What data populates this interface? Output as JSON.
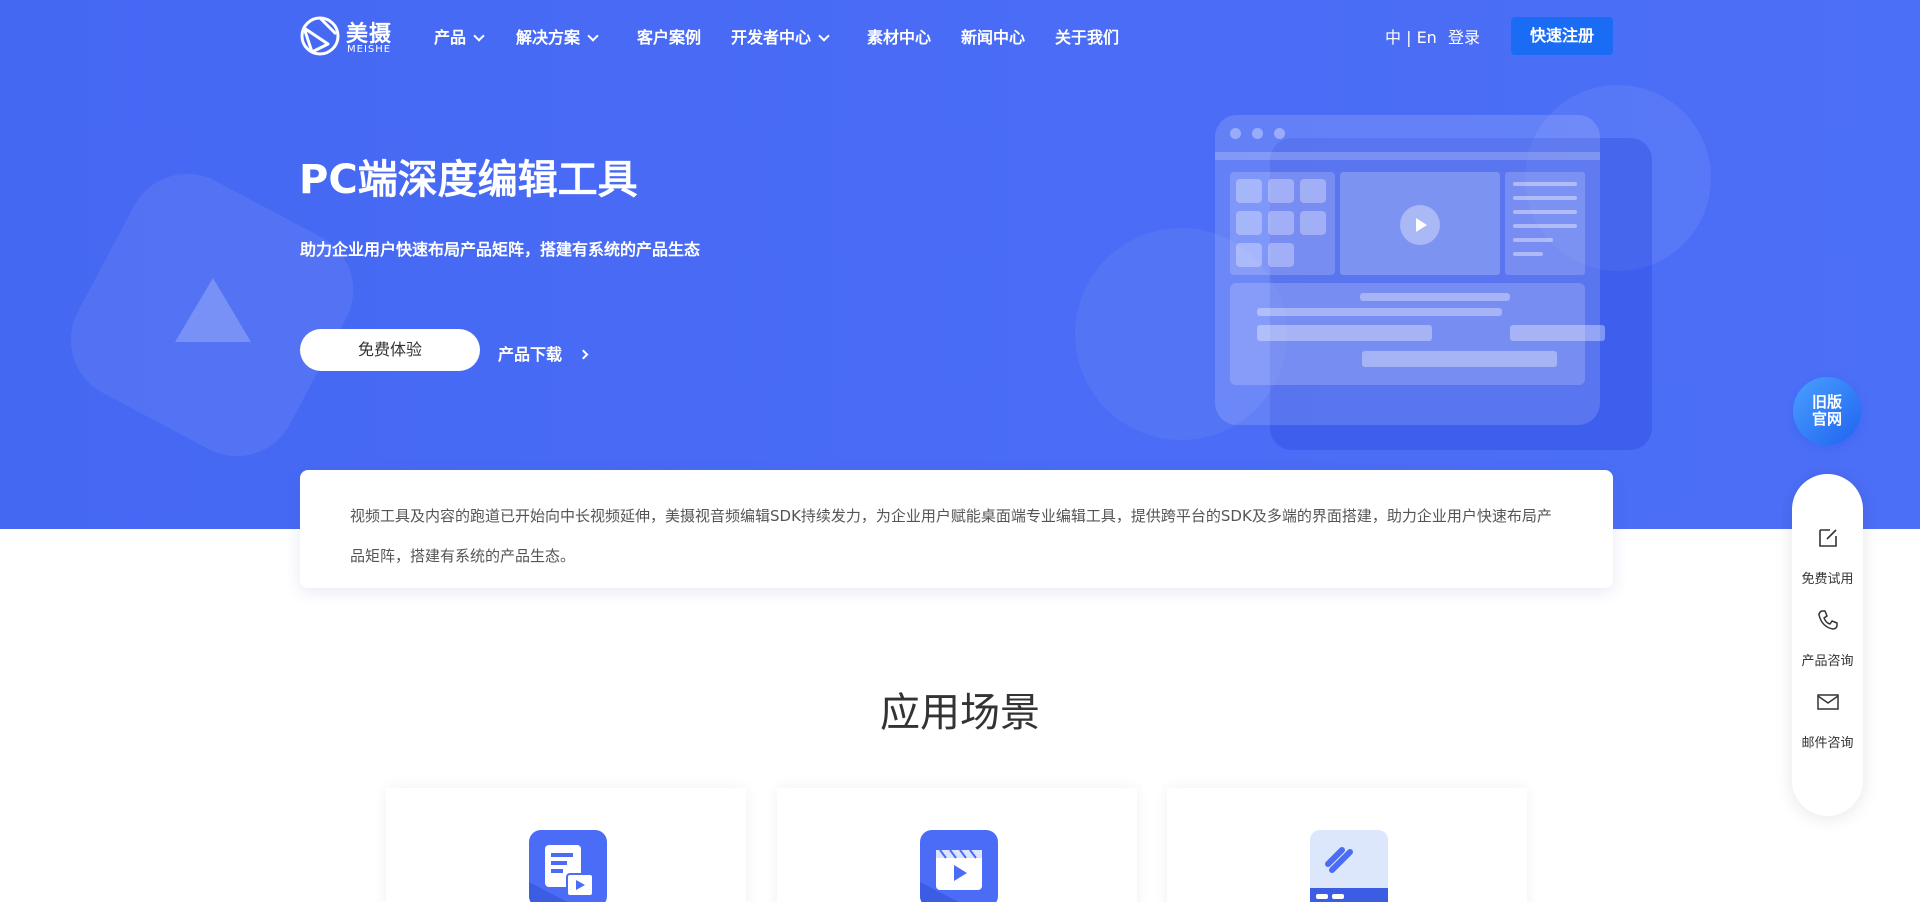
{
  "brand": {
    "name_cn": "美摄",
    "name_en": "MEISHE"
  },
  "nav": {
    "items": [
      {
        "label": "产品",
        "dropdown": true
      },
      {
        "label": "解决方案",
        "dropdown": true
      },
      {
        "label": "客户案例",
        "dropdown": false
      },
      {
        "label": "开发者中心",
        "dropdown": true
      },
      {
        "label": "素材中心",
        "dropdown": false
      },
      {
        "label": "新闻中心",
        "dropdown": false
      },
      {
        "label": "关于我们",
        "dropdown": false
      }
    ],
    "lang": "中 | En",
    "login": "登录",
    "register": "快速注册"
  },
  "hero": {
    "title": "PC端深度编辑工具",
    "subtitle": "助力企业用户快速布局产品矩阵，搭建有系统的产品生态",
    "trial_button": "免费体验",
    "download_link": "产品下载"
  },
  "intro": {
    "text": "视频工具及内容的跑道已开始向中长视频延伸，美摄视音频编辑SDK持续发力，为企业用户赋能桌面端专业编辑工具，提供跨平台的SDK及多端的界面搭建，助力企业用户快速布局产品矩阵，搭建有系统的产品生态。"
  },
  "section": {
    "title": "应用场景"
  },
  "scenes": [
    {
      "icon": "document-video-icon"
    },
    {
      "icon": "video-clapper-icon"
    },
    {
      "icon": "editor-window-icon"
    }
  ],
  "floating": {
    "old_site": "旧版官网",
    "items": [
      {
        "label": "免费试用",
        "icon": "edit-icon"
      },
      {
        "label": "产品咨询",
        "icon": "phone-icon"
      },
      {
        "label": "邮件咨询",
        "icon": "mail-icon"
      }
    ]
  },
  "colors": {
    "hero_bg": "#4a6cf6",
    "register_btn": "#1a6cf5",
    "accent": "#4a6cf6"
  }
}
